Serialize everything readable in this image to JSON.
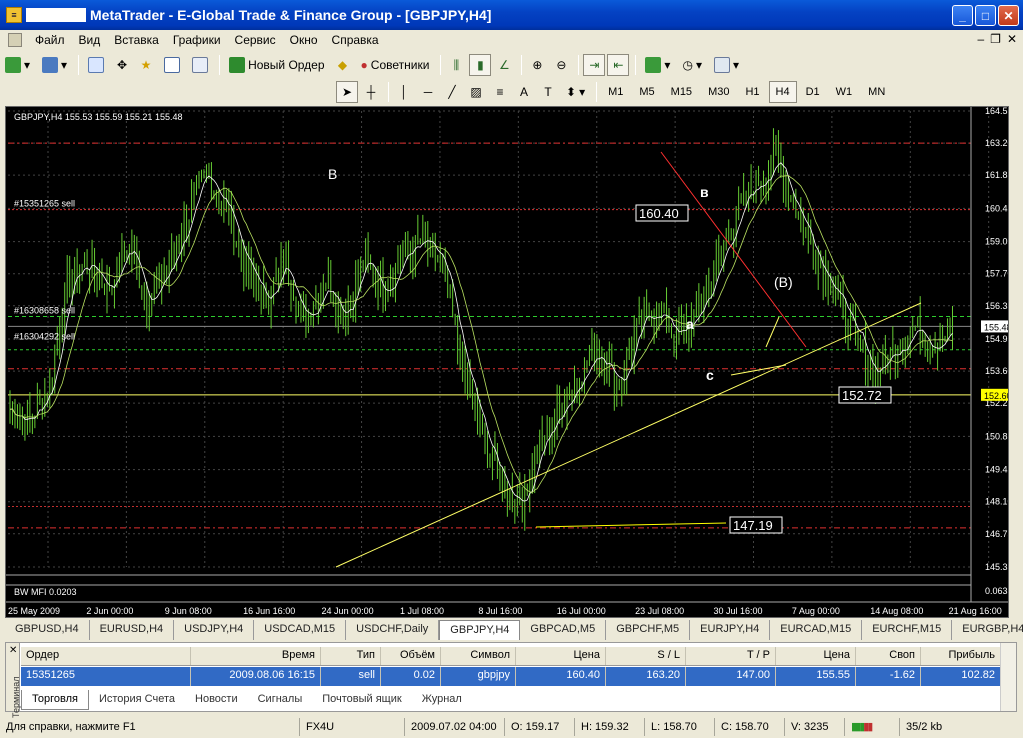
{
  "window": {
    "title": "MetaTrader - E-Global Trade & Finance Group - [GBPJPY,H4]"
  },
  "menu": [
    "Файл",
    "Вид",
    "Вставка",
    "Графики",
    "Сервис",
    "Окно",
    "Справка"
  ],
  "toolbar": {
    "new_order": "Новый Ордер",
    "experts": "Советники"
  },
  "timeframes": [
    "M1",
    "M5",
    "M15",
    "M30",
    "H1",
    "H4",
    "D1",
    "W1",
    "MN"
  ],
  "active_timeframe": "H4",
  "chart": {
    "info": "GBPJPY,H4  155.53 155.59 155.21 155.48",
    "indicator_label": "BW MFI 0.0203",
    "indicator_axis_value": "0.0635",
    "price_ticks": [
      "164.55",
      "163.20",
      "161.85",
      "160.45",
      "159.05",
      "157.70",
      "156.35",
      "154.95",
      "153.60",
      "152.25",
      "150.85",
      "149.45",
      "148.10",
      "146.75",
      "145.35"
    ],
    "current_price": "155.48",
    "marked_price": "152.60",
    "date_labels": [
      "25 May 2009",
      "2 Jun 00:00",
      "9 Jun 08:00",
      "16 Jun 16:00",
      "24 Jun 00:00",
      "1 Jul 08:00",
      "8 Jul 16:00",
      "16 Jul 00:00",
      "23 Jul 08:00",
      "30 Jul 16:00",
      "7 Aug 00:00",
      "14 Aug 08:00",
      "21 Aug 16:00"
    ],
    "order_labels": [
      "#15351265 sell",
      "#16308658 sell",
      "#16304292 sell"
    ],
    "wave_labels": [
      "B",
      "в",
      "(B)",
      "a",
      "c"
    ],
    "price_callouts": [
      "160.40",
      "152.72",
      "147.19"
    ]
  },
  "chart_data": {
    "type": "candlestick",
    "symbol": "GBPJPY",
    "timeframe": "H4",
    "last_bar": {
      "open": 155.53,
      "high": 155.59,
      "low": 155.21,
      "close": 155.48
    },
    "ylim": [
      145.35,
      164.55
    ],
    "x_range": [
      "25 May 2009",
      "21 Aug 16:00"
    ],
    "approx_close_path": [
      152.0,
      151.5,
      153.0,
      157.5,
      158.2,
      157.0,
      159.0,
      156.5,
      157.8,
      160.0,
      161.9,
      160.5,
      158.0,
      156.5,
      158.2,
      155.6,
      157.5,
      156.0,
      158.3,
      157.0,
      158.5,
      159.0,
      158.0,
      154.0,
      151.0,
      149.0,
      148.0,
      150.5,
      152.0,
      153.5,
      154.5,
      153.0,
      155.5,
      156.2,
      155.0,
      156.0,
      158.0,
      160.2,
      161.5,
      162.5,
      160.5,
      158.5,
      157.0,
      155.0,
      153.5,
      154.5,
      155.5,
      154.8,
      155.48
    ],
    "grid": true
  },
  "tabs": [
    "GBPUSD,H4",
    "EURUSD,H4",
    "USDJPY,H4",
    "USDCAD,M15",
    "USDCHF,Daily",
    "GBPJPY,H4",
    "GBPCAD,M5",
    "GBPCHF,M5",
    "EURJPY,H4",
    "EURCAD,M15",
    "EURCHF,M15",
    "EURGBP,H4"
  ],
  "active_tab": "GBPJPY,H4",
  "terminal": {
    "side_label": "Терминал",
    "columns": [
      "Ордер",
      "Время",
      "Тип",
      "Объём",
      "Символ",
      "Цена",
      "S / L",
      "T / P",
      "Цена",
      "Своп",
      "Прибыль"
    ],
    "row": [
      "15351265",
      "2009.08.06 16:15",
      "sell",
      "0.02",
      "gbpjpy",
      "160.40",
      "163.20",
      "147.00",
      "155.55",
      "-1.62",
      "102.82"
    ],
    "tabs": [
      "Торговля",
      "История Счета",
      "Новости",
      "Сигналы",
      "Почтовый ящик",
      "Журнал"
    ]
  },
  "status": {
    "help": "Для справки, нажмите F1",
    "profile": "FX4U",
    "datetime": "2009.07.02 04:00",
    "open": "O: 159.17",
    "high": "H: 159.32",
    "low": "L: 158.70",
    "close": "C: 158.70",
    "volume": "V: 3235",
    "traffic": "35/2 kb"
  },
  "colors": {
    "candle": "#66cc33",
    "ma": "#ffffff",
    "trendline": "#ffff66",
    "stop": "#ff3333",
    "grid": "#555555"
  }
}
